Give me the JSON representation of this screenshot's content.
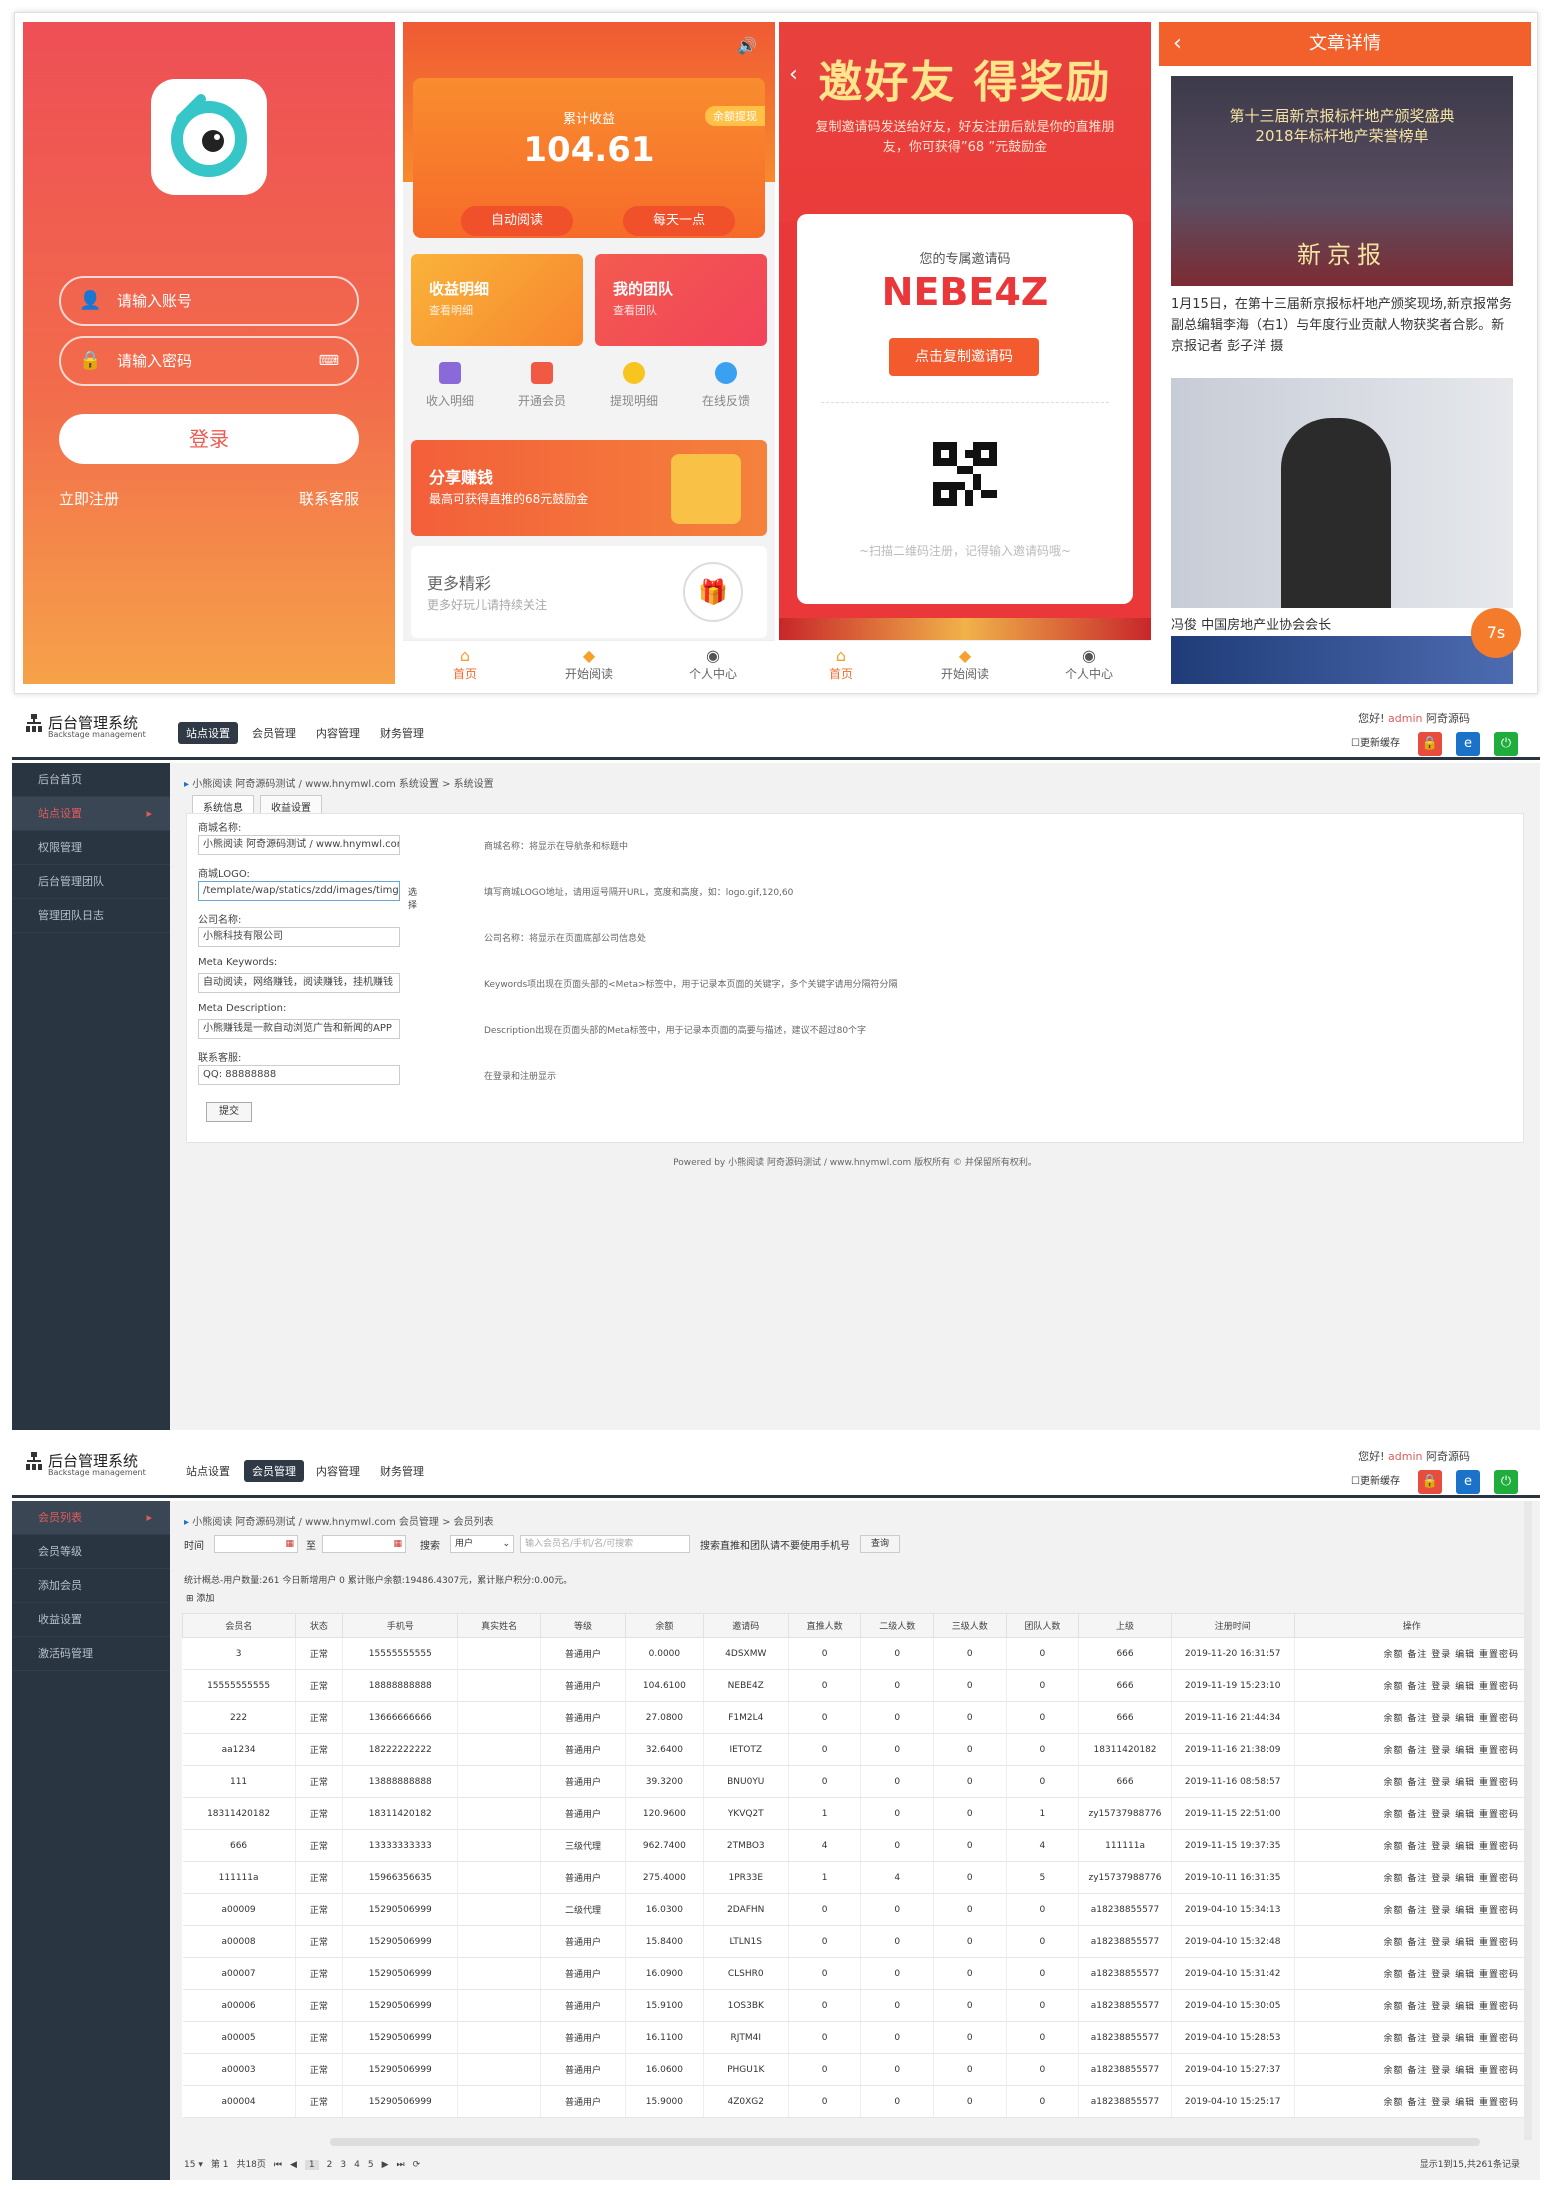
{
  "login": {
    "phone_placeholder": "请输入账号",
    "pwd_placeholder": "请输入密码",
    "login_btn": "登录",
    "register": "立即注册",
    "service": "联系客服"
  },
  "home": {
    "earn_label": "累计收益",
    "earn_value": "104.61",
    "earn_badge": "余额提现",
    "btn_auto": "自动阅读",
    "btn_daily": "每天一点",
    "tile1_t": "收益明细",
    "tile1_s": "查看明细",
    "tile2_t": "我的团队",
    "tile2_s": "查看团队",
    "minis": [
      "收入明细",
      "开通会员",
      "提现明细",
      "在线反馈"
    ],
    "share_t": "分享赚钱",
    "share_s": "最高可获得直推的68元鼓励金",
    "more_t": "更多精彩",
    "more_s": "更多好玩儿请持续关注",
    "tabs": [
      "首页",
      "开始阅读",
      "个人中心"
    ]
  },
  "invite": {
    "title": "邀好友 得奖励",
    "subtitle": "复制邀请码发送给好友，好友注册后就是你的直推朋友，你可获得”68 ”元鼓励金",
    "card_title": "您的专属邀请码",
    "code": "NEBE4Z",
    "copy_btn": "点击复制邀请码",
    "hint": "~扫描二维码注册，记得输入邀请码哦~"
  },
  "article": {
    "title": "文章详情",
    "img1_cap": "第十三届新京报标杆地产颁奖盛典\n2018年标杆地产荣誉榜单",
    "img1_brand": "新京报",
    "text": "1月15日，在第十三届新京报标杆地产颁奖现场,新京报常务副总编辑李海（右1）与年度行业贡献人物获奖者合影。新京报记者 彭子洋 摄",
    "cap2": "冯俊 中国房地产业协会会长",
    "timer": "7s"
  },
  "admin": {
    "brand": "后台管理系统",
    "brand_sub": "Backstage management",
    "nav": [
      "站点设置",
      "会员管理",
      "内容管理",
      "财务管理"
    ],
    "greet_pre": "您好!",
    "greet_user": "admin",
    "greet_site": "阿奇源码",
    "cache": "更新缓存",
    "side1": [
      "后台首页",
      "站点设置",
      "权限管理",
      "后台管理团队",
      "管理团队日志"
    ],
    "crumb1": "小熊阅读 阿奇源码测试 / www.hnymwl.com 系统设置 > 系统设置",
    "tabs1": [
      "系统信息",
      "收益设置"
    ],
    "fields": [
      {
        "label": "商城名称:",
        "value": "小熊阅读 阿奇源码测试 / www.hnymwl.cor",
        "hint": "商城名称：将显示在导航条和标题中"
      },
      {
        "label": "商城LOGO:",
        "value": "/template/wap/statics/zdd/images/timg.gif",
        "extra": "选择",
        "hint": "填写商城LOGO地址，请用逗号隔开URL，宽度和高度，如：logo.gif,120,60"
      },
      {
        "label": "公司名称:",
        "value": "小熊科技有限公司",
        "hint": "公司名称：将显示在页面底部公司信息处"
      },
      {
        "label": "Meta Keywords:",
        "value": "自动阅读，网络赚钱，阅读赚钱，挂机赚钱",
        "hint": "Keywords项出现在页面头部的<Meta>标签中，用于记录本页面的关键字，多个关键字请用分隔符分隔"
      },
      {
        "label": "Meta Description:",
        "value": "小熊赚钱是一款自动浏览广告和新闻的APP",
        "hint": "Description出现在页面头部的Meta标签中，用于记录本页面的高要与描述，建议不超过80个字"
      },
      {
        "label": "联系客服:",
        "value": "QQ: 88888888",
        "hint": "在登录和注册显示"
      }
    ],
    "submit": "提交",
    "powered": "Powered by 小熊阅读 阿奇源码测试 / www.hnymwl.com 版权所有 © 并保留所有权利。",
    "side2": [
      "会员列表",
      "会员等级",
      "添加会员",
      "收益设置",
      "激活码管理"
    ],
    "crumb2": "小熊阅读 阿奇源码测试 / www.hnymwl.com 会员管理 > 会员列表",
    "f_time": "时间",
    "f_to": "至",
    "f_search": "搜索",
    "f_type": "用户",
    "f_placeholder": "输入会员名/手机/名/可搜索",
    "f_note": "搜索直推和团队请不要使用手机号",
    "f_query": "查询",
    "stats": "统计概总-用户数量:261  今日新增用户 0   累计账户余额:19486.4307元，累计账户积分:0.00元。",
    "add": "添加",
    "headers": [
      "会员名",
      "状态",
      "手机号",
      "真实姓名",
      "等级",
      "余额",
      "邀请码",
      "直推人数",
      "二级人数",
      "三级人数",
      "团队人数",
      "上级",
      "注册时间",
      "操作"
    ],
    "ops": "余额  备注  登录  编辑  重置密码",
    "rows": [
      [
        "3",
        "正常",
        "15555555555",
        "",
        "普通用户",
        "0.0000",
        "4DSXMW",
        "0",
        "0",
        "0",
        "0",
        "666",
        "2019-11-20 16:31:57"
      ],
      [
        "15555555555",
        "正常",
        "18888888888",
        "",
        "普通用户",
        "104.6100",
        "NEBE4Z",
        "0",
        "0",
        "0",
        "0",
        "666",
        "2019-11-19 15:23:10"
      ],
      [
        "222",
        "正常",
        "13666666666",
        "",
        "普通用户",
        "27.0800",
        "F1M2L4",
        "0",
        "0",
        "0",
        "0",
        "666",
        "2019-11-16 21:44:34"
      ],
      [
        "aa1234",
        "正常",
        "18222222222",
        "",
        "普通用户",
        "32.6400",
        "IETOTZ",
        "0",
        "0",
        "0",
        "0",
        "18311420182",
        "2019-11-16 21:38:09"
      ],
      [
        "111",
        "正常",
        "13888888888",
        "",
        "普通用户",
        "39.3200",
        "BNU0YU",
        "0",
        "0",
        "0",
        "0",
        "666",
        "2019-11-16 08:58:57"
      ],
      [
        "18311420182",
        "正常",
        "18311420182",
        "",
        "普通用户",
        "120.9600",
        "YKVQ2T",
        "1",
        "0",
        "0",
        "1",
        "zy15737988776",
        "2019-11-15 22:51:00"
      ],
      [
        "666",
        "正常",
        "13333333333",
        "",
        "三级代理",
        "962.7400",
        "2TMBO3",
        "4",
        "0",
        "0",
        "4",
        "111111a",
        "2019-11-15 19:37:35"
      ],
      [
        "111111a",
        "正常",
        "15966356635",
        "",
        "普通用户",
        "275.4000",
        "1PR33E",
        "1",
        "4",
        "0",
        "5",
        "zy15737988776",
        "2019-10-11 16:31:35"
      ],
      [
        "a00009",
        "正常",
        "15290506999",
        "",
        "二级代理",
        "16.0300",
        "2DAFHN",
        "0",
        "0",
        "0",
        "0",
        "a18238855577",
        "2019-04-10 15:34:13"
      ],
      [
        "a00008",
        "正常",
        "15290506999",
        "",
        "普通用户",
        "15.8400",
        "LTLN1S",
        "0",
        "0",
        "0",
        "0",
        "a18238855577",
        "2019-04-10 15:32:48"
      ],
      [
        "a00007",
        "正常",
        "15290506999",
        "",
        "普通用户",
        "16.0900",
        "CLSHR0",
        "0",
        "0",
        "0",
        "0",
        "a18238855577",
        "2019-04-10 15:31:42"
      ],
      [
        "a00006",
        "正常",
        "15290506999",
        "",
        "普通用户",
        "15.9100",
        "1OS3BK",
        "0",
        "0",
        "0",
        "0",
        "a18238855577",
        "2019-04-10 15:30:05"
      ],
      [
        "a00005",
        "正常",
        "15290506999",
        "",
        "普通用户",
        "16.1100",
        "RJTM4I",
        "0",
        "0",
        "0",
        "0",
        "a18238855577",
        "2019-04-10 15:28:53"
      ],
      [
        "a00003",
        "正常",
        "15290506999",
        "",
        "普通用户",
        "16.0600",
        "PHGU1K",
        "0",
        "0",
        "0",
        "0",
        "a18238855577",
        "2019-04-10 15:27:37"
      ],
      [
        "a00004",
        "正常",
        "15290506999",
        "",
        "普通用户",
        "15.9000",
        "4Z0XG2",
        "0",
        "0",
        "0",
        "0",
        "a18238855577",
        "2019-04-10 15:25:17"
      ]
    ],
    "pager": [
      "15 ▾",
      "第 1",
      "共18页",
      "⏮",
      "◀",
      "1",
      "2",
      "3",
      "4",
      "5",
      "▶",
      "⏭",
      "⟳"
    ],
    "pinfo": "显示1到15,共261条记录"
  }
}
